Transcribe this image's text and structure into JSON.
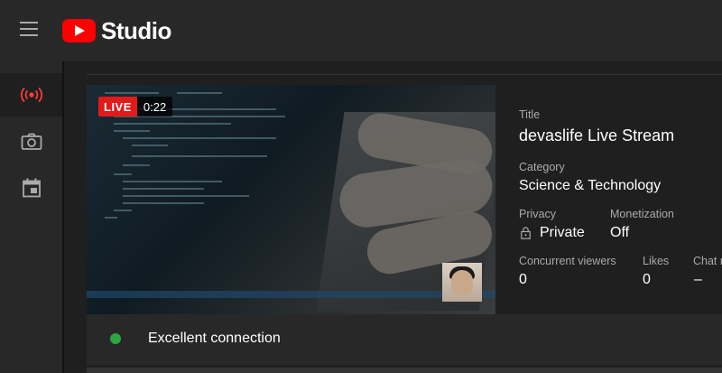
{
  "app": {
    "logo_text": "Studio",
    "brand_color": "#ff0000"
  },
  "rail": {
    "items": [
      {
        "icon": "live-broadcast-icon",
        "active": true
      },
      {
        "icon": "camera-icon",
        "active": false
      },
      {
        "icon": "calendar-icon",
        "active": false
      }
    ]
  },
  "preview": {
    "live_label": "LIVE",
    "elapsed": "0:22"
  },
  "details": {
    "title_label": "Title",
    "title_value": "devaslife Live Stream",
    "category_label": "Category",
    "category_value": "Science & Technology",
    "privacy_label": "Privacy",
    "privacy_value": "Private",
    "monetization_label": "Monetization",
    "monetization_value": "Off",
    "viewers_label": "Concurrent viewers",
    "viewers_value": "0",
    "likes_label": "Likes",
    "likes_value": "0",
    "chat_label": "Chat r",
    "chat_value": "–"
  },
  "connection": {
    "status": "Excellent connection",
    "status_color": "#2ba640"
  }
}
